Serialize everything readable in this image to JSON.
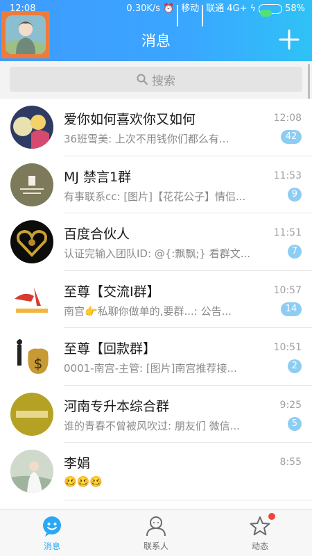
{
  "status": {
    "time": "12:08",
    "speed": "0.30K/s",
    "carrier1": "移动",
    "carrier2": "联通",
    "network": "4G+",
    "battery": "58%",
    "battery_level": 0.58
  },
  "header": {
    "title": "消息"
  },
  "search": {
    "placeholder": "搜索"
  },
  "conversations": [
    {
      "name": "爱你如何喜欢你又如何",
      "msg": "36班雪美: 上次不用钱你们都么有...",
      "time": "12:08",
      "badge": "42"
    },
    {
      "name": "MJ 禁言1群",
      "msg": "有事联系cc: [图片]【花花公子】情侣...",
      "time": "11:53",
      "badge": "9"
    },
    {
      "name": "百度合伙人",
      "msg": "认证完输入团队ID: @{:飘飘;} 看群文...",
      "time": "11:51",
      "badge": "7"
    },
    {
      "name": "至尊【交流I群】",
      "msg": "南宫👉私聊你做单的,要群...: 公告...",
      "time": "10:57",
      "badge": "14"
    },
    {
      "name": "至尊【回款群】",
      "msg": "0001-南宫-主管: [图片]南宫推荐接...",
      "time": "10:51",
      "badge": "2"
    },
    {
      "name": "河南专升本综合群",
      "msg": "谁的青春不曾被风吹过: 朋友们 微信...",
      "time": "9:25",
      "badge": "5"
    },
    {
      "name": "李娟",
      "msg": "🥴🥴🥴",
      "time": "8:55",
      "badge": ""
    }
  ],
  "nav": {
    "messages": "消息",
    "contacts": "联系人",
    "feeds": "动态"
  },
  "colors": {
    "header_gradient_start": "#3f9bff",
    "header_gradient_end": "#2fc2f6",
    "badge": "#8ecdf3",
    "active_tab": "#2aa8f5",
    "highlight_border": "#f07a3a",
    "notify_dot": "#f4433b"
  }
}
